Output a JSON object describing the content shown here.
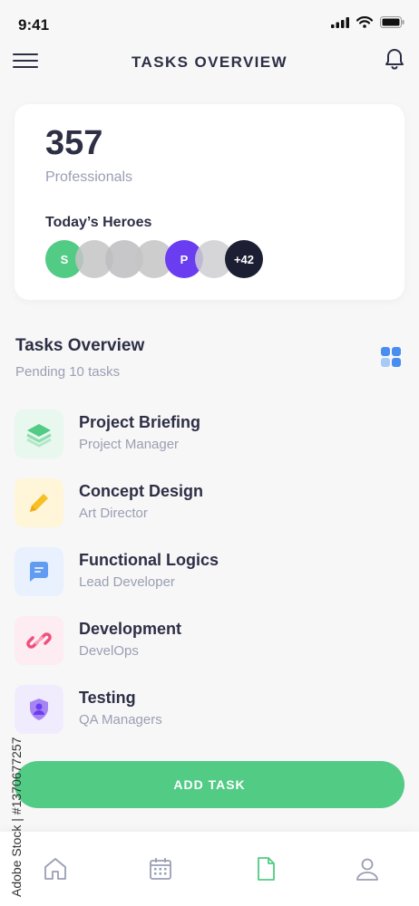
{
  "status": {
    "time": "9:41"
  },
  "header": {
    "title": "TASKS OVERVIEW"
  },
  "stats": {
    "count": "357",
    "label": "Professionals",
    "heroes_title": "Today’s Heroes"
  },
  "heroes": [
    {
      "initial": "S",
      "color": "#52cb85"
    },
    {
      "initial": "",
      "color": "#c4c4c6"
    },
    {
      "initial": "",
      "color": "#bdbdbf"
    },
    {
      "initial": "",
      "color": "#c4c4c6"
    },
    {
      "initial": "P",
      "color": "#6a3df0"
    },
    {
      "initial": "",
      "color": "#cfcfd1"
    },
    {
      "initial": "+42",
      "color": "#1c1f33"
    }
  ],
  "overview": {
    "title": "Tasks Overview",
    "subtitle": "Pending 10 tasks"
  },
  "tasks": [
    {
      "title": "Project Briefing",
      "role": "Project Manager",
      "icon": "layers-icon",
      "bg": "#e8f8ee",
      "color": "#52cb85"
    },
    {
      "title": "Concept Design",
      "role": "Art Director",
      "icon": "pencil-icon",
      "bg": "#fff5d9",
      "color": "#f5c024"
    },
    {
      "title": "Functional Logics",
      "role": "Lead Developer",
      "icon": "message-icon",
      "bg": "#e8f1fd",
      "color": "#4a8df0"
    },
    {
      "title": "Development",
      "role": "DevelOps",
      "icon": "link-icon",
      "bg": "#fdecf1",
      "color": "#ef4f7c"
    },
    {
      "title": "Testing",
      "role": "QA Managers",
      "icon": "shield-user-icon",
      "bg": "#f1ecfd",
      "color": "#8a5cf0"
    }
  ],
  "actions": {
    "add_task": "ADD TASK"
  },
  "tabs": [
    {
      "name": "home",
      "icon": "home-icon",
      "active": false
    },
    {
      "name": "calendar",
      "icon": "calendar-icon",
      "active": false
    },
    {
      "name": "document",
      "icon": "document-icon",
      "active": true
    },
    {
      "name": "profile",
      "icon": "user-icon",
      "active": false
    }
  ],
  "watermark": "Adobe Stock | #1370677257",
  "colors": {
    "accent": "#52cb85",
    "text": "#2d2f45",
    "muted": "#9a9fb2"
  }
}
